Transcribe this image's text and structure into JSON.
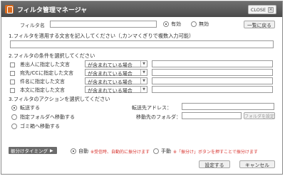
{
  "window": {
    "title": "フィルタ管理マネージャ",
    "close_label": "CLOSE",
    "close_icon": "x-icon"
  },
  "filter_name": {
    "label": "フィルタ名",
    "value": "",
    "radio_enabled": "有効",
    "radio_disabled": "無効",
    "back_button": "一覧に戻る"
  },
  "section1": {
    "title": "1.フィルタを適用する文言を記入してください（,カンマくぎりで複数入力可能）",
    "value": ""
  },
  "section2": {
    "title": "2.フィルタの条件を選択してください",
    "conditions": [
      {
        "label": "差出人に指定した文言",
        "select": "が含まれている場合",
        "value": ""
      },
      {
        "label": "宛先/CCに指定した文言",
        "select": "が含まれている場合",
        "value": ""
      },
      {
        "label": "件名に指定した文言",
        "select": "が含まれている場合",
        "value": ""
      },
      {
        "label": "本文に指定した文言",
        "select": "が含まれている場合",
        "value": ""
      }
    ]
  },
  "section3": {
    "title": "3.フィルタのアクションを選択してください",
    "actions": [
      {
        "label": "転送する"
      },
      {
        "label": "指定フォルダへ移動する"
      },
      {
        "label": "ゴミ箱へ移動する"
      }
    ],
    "forward_label": "転送先アドレス：",
    "forward_value": "",
    "move_label": "移動先のフォルダ：",
    "move_value": "",
    "folder_setting_button": "フォルダを設定"
  },
  "timing": {
    "tag_label": "振分けタイミング",
    "auto_label": "自動",
    "auto_note": "※受信時、自動的に振分けます",
    "manual_label": "手動",
    "manual_note": "※「振分け」ボタンを押すことで振分けます"
  },
  "footer": {
    "save": "設定する",
    "cancel": "キャンセル"
  }
}
